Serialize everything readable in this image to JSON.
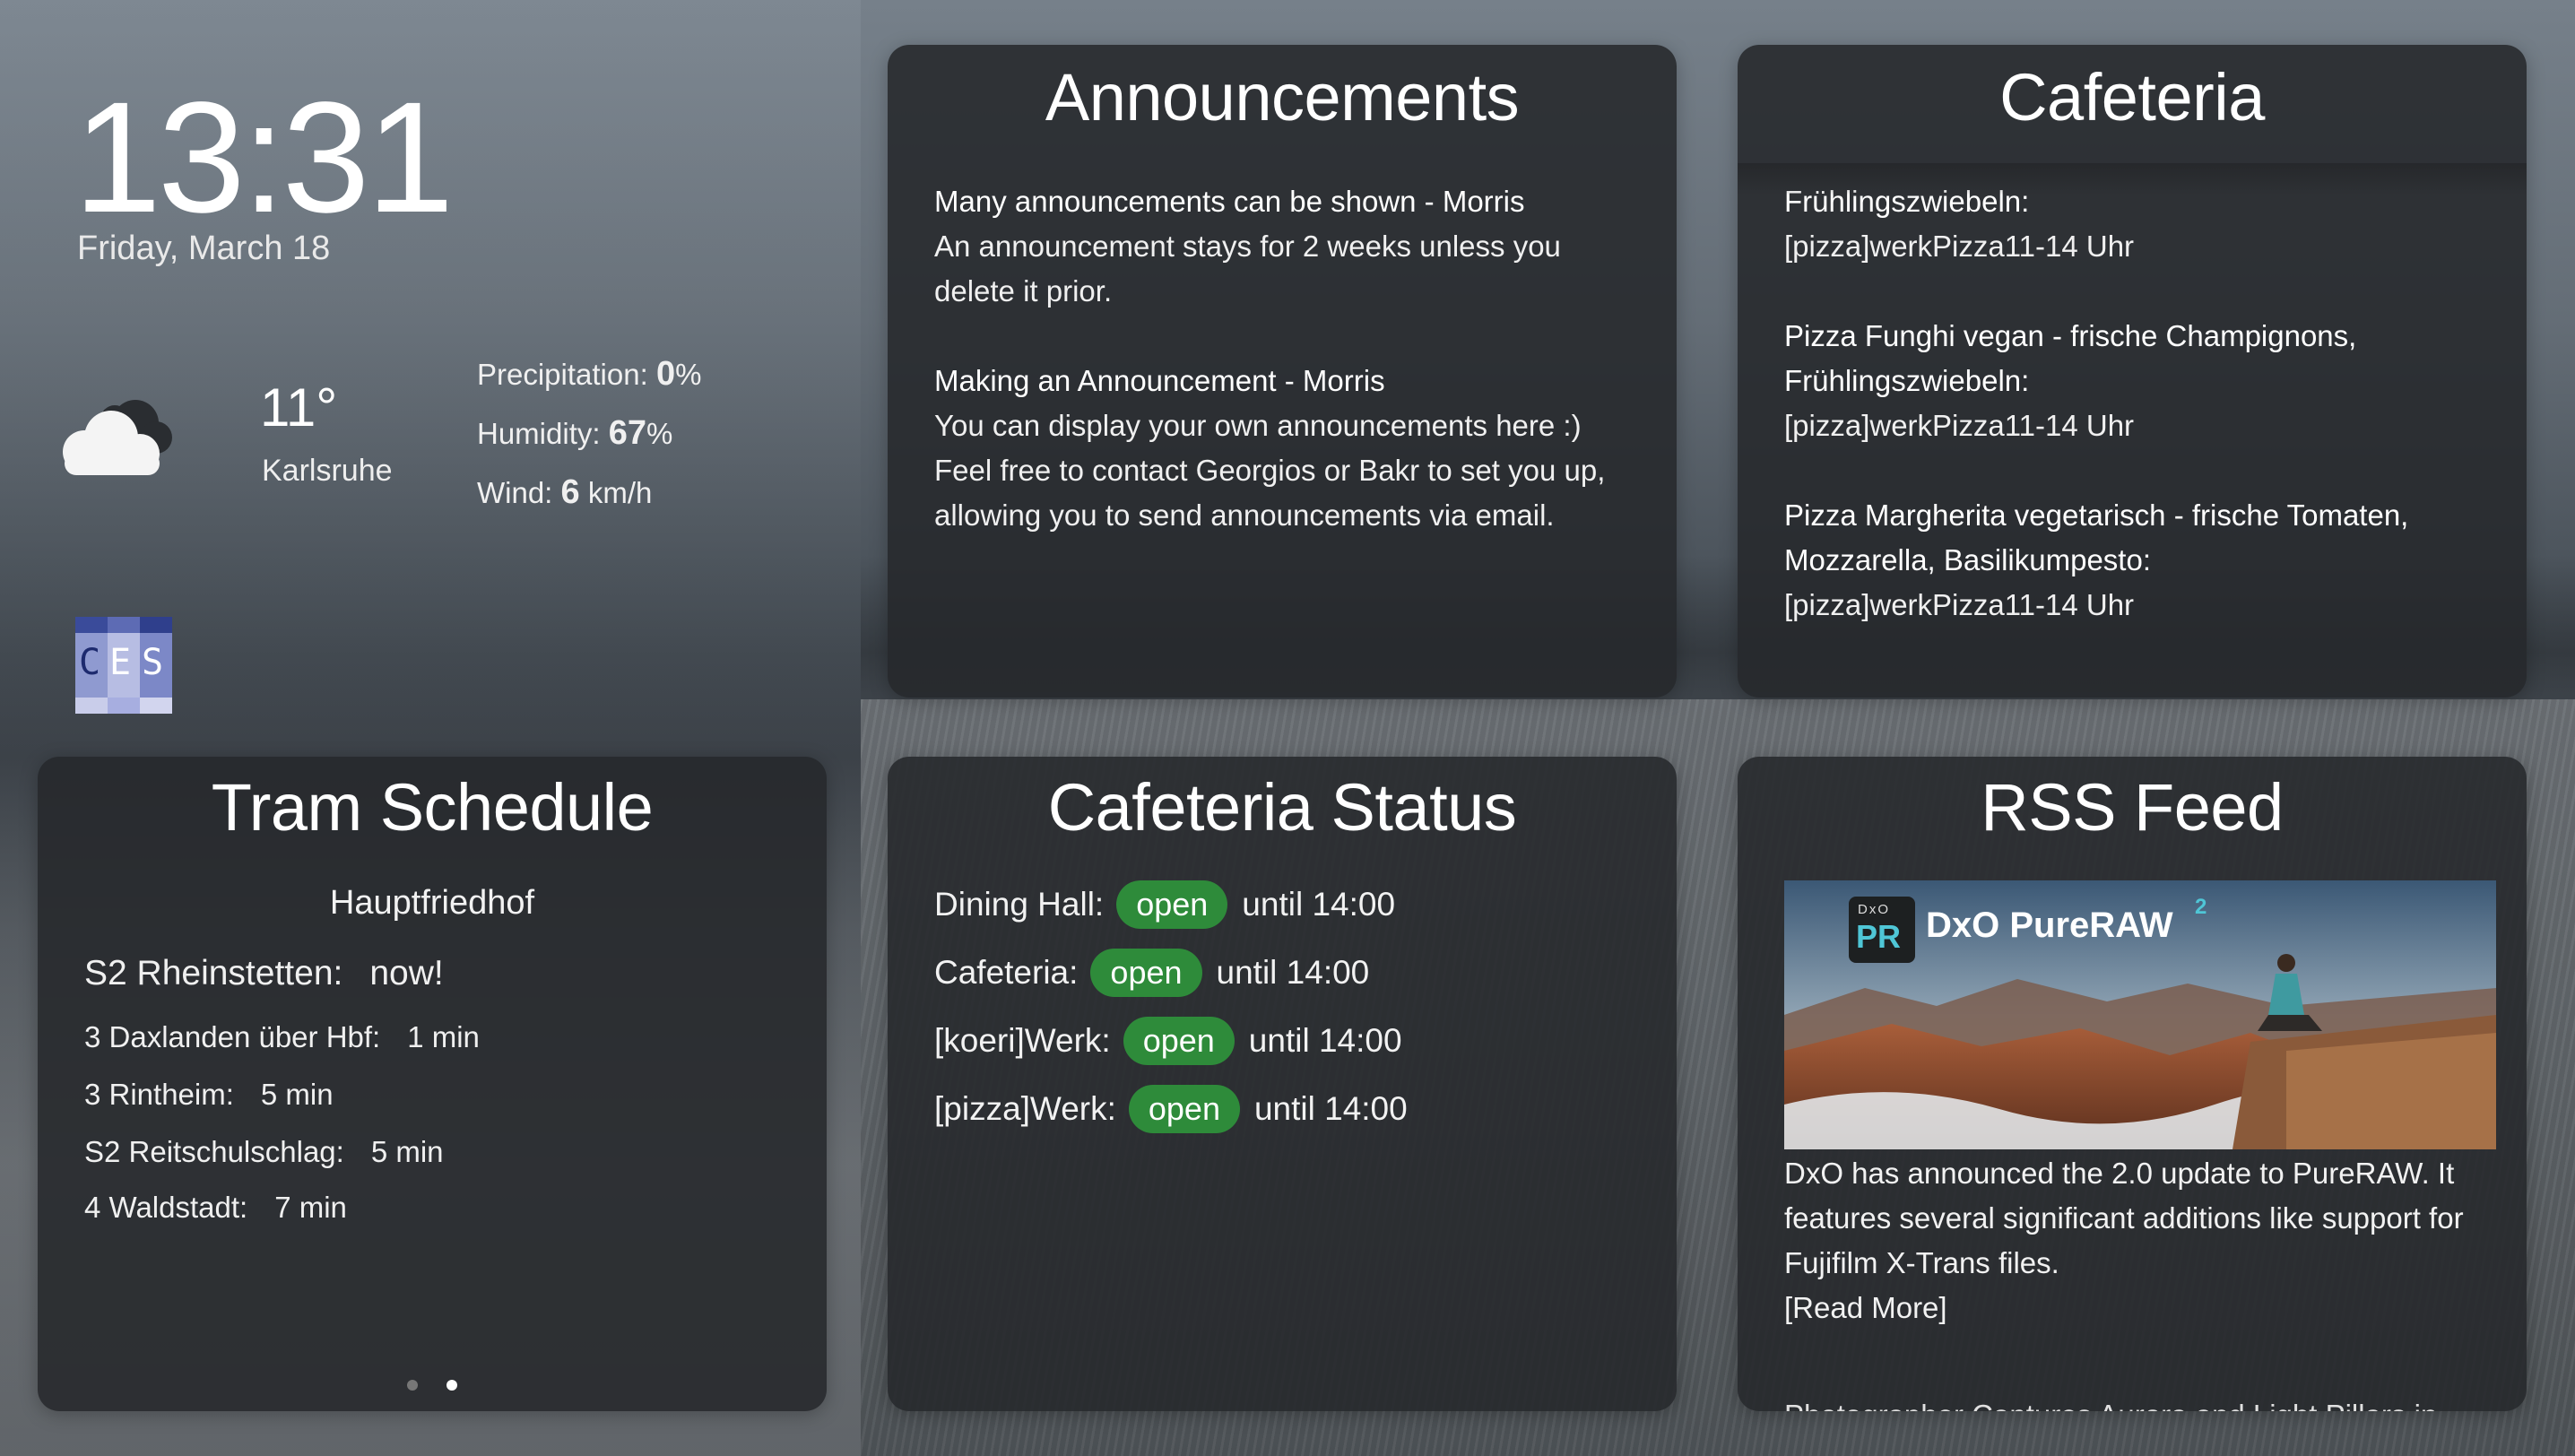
{
  "clock": {
    "time": "13:31",
    "date": "Friday, March 18"
  },
  "weather": {
    "icon": "cloud-icon",
    "temperature": "11°",
    "city": "Karlsruhe",
    "precipitation_label": "Precipitation:",
    "precipitation_value": "0",
    "precipitation_unit": "%",
    "humidity_label": "Humidity:",
    "humidity_value": "67",
    "humidity_unit": "%",
    "wind_label": "Wind:",
    "wind_value": "6",
    "wind_unit": "km/h"
  },
  "logo": {
    "letters": [
      "C",
      "E",
      "S"
    ]
  },
  "announcements": {
    "title": "Announcements",
    "items": [
      {
        "heading": "Many announcements can be shown - Morris",
        "body": "An announcement stays for 2 weeks unless you delete it prior."
      },
      {
        "heading": "Making an Announcement - Morris",
        "body": "You can display your own announcements here :) Feel free to contact Georgios or Bakr to set you up, allowing you to send announcements via email."
      }
    ]
  },
  "cafeteria": {
    "title": "Cafeteria",
    "items": [
      {
        "dish": "Frühlingszwiebeln:",
        "location": "[pizza]werkPizza11-14 Uhr"
      },
      {
        "dish": "Pizza Funghi vegan - frische Champignons, Frühlingszwiebeln:",
        "location": "[pizza]werkPizza11-14 Uhr"
      },
      {
        "dish": "Pizza Margherita vegetarisch - frische Tomaten, Mozzarella, Basilikumpesto:",
        "location": "[pizza]werkPizza11-14 Uhr"
      }
    ]
  },
  "tram": {
    "title": "Tram Schedule",
    "station": "Hauptfriedhof",
    "departures": [
      {
        "line": "S2 Rheinstetten:",
        "time": "now!"
      },
      {
        "line": "3 Daxlanden über Hbf:",
        "time": "1 min"
      },
      {
        "line": "3 Rintheim:",
        "time": "5 min"
      },
      {
        "line": "S2 Reitschulschlag:",
        "time": "5 min"
      },
      {
        "line": "4 Waldstadt:",
        "time": "7 min"
      }
    ]
  },
  "status": {
    "title": "Cafeteria Status",
    "badge_color": "#2e8b3a",
    "rows": [
      {
        "name": "Dining Hall:",
        "state": "open",
        "until": "until 14:00"
      },
      {
        "name": "Cafeteria:",
        "state": "open",
        "until": "until 14:00"
      },
      {
        "name": "[koeri]Werk:",
        "state": "open",
        "until": "until 14:00"
      },
      {
        "name": "[pizza]Werk:",
        "state": "open",
        "until": "until 14:00"
      }
    ]
  },
  "rss": {
    "title": "RSS Feed",
    "image_brand_small": "DxO",
    "image_brand_badge": "PR",
    "image_brand_name": "DxO PureRAW",
    "image_brand_version": "2",
    "body": "DxO has announced the 2.0 update to PureRAW. It features several significant additions like support for Fujifilm X-Trans files.",
    "read_more": "[Read More]",
    "next_item": "Photographer Captures Aurora and Light Pillars in"
  }
}
